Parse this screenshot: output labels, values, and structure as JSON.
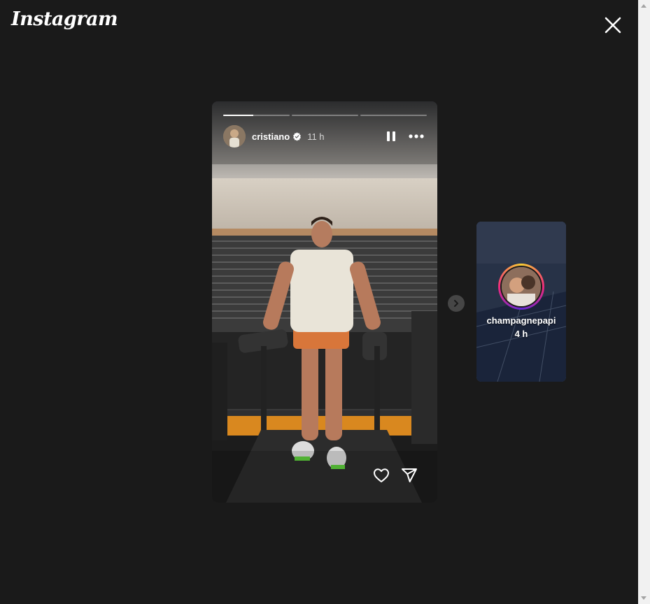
{
  "app": {
    "logo_text": "Instagram"
  },
  "icons": {
    "close": "close-icon",
    "pause": "pause-icon",
    "more": "more-horizontal-icon",
    "like": "heart-icon",
    "share": "paper-plane-icon",
    "next": "chevron-right-icon",
    "verified": "verified-badge-icon"
  },
  "story": {
    "username": "cristiano",
    "time": "11 h",
    "progress": [
      0.45,
      0,
      0
    ]
  },
  "next_story": {
    "username": "champagnepapi",
    "time": "4 h"
  },
  "colors": {
    "background": "#1a1a1a",
    "verified": "#ffffff"
  }
}
